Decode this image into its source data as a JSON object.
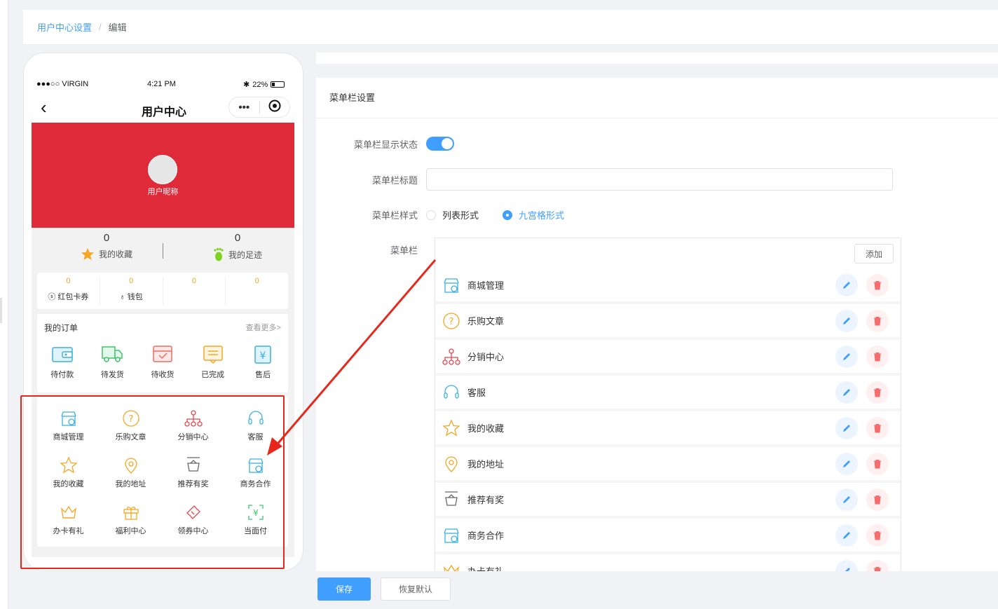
{
  "breadcrumb": {
    "parent": "用户中心设置",
    "separator": "/",
    "current": "编辑"
  },
  "phone": {
    "status": {
      "carrier": "●●●○○ VIRGIN",
      "time": "4:21 PM",
      "battery": "22%"
    },
    "nav_title": "用户中心",
    "capsule": {
      "more": "•••"
    },
    "nickname": "用户昵称",
    "stats": [
      {
        "value": "0",
        "label": "我的收藏"
      },
      {
        "value": "0",
        "label": "我的足迹"
      }
    ],
    "wallet": [
      {
        "value": "0",
        "label": "红包卡券"
      },
      {
        "value": "0",
        "label": "钱包"
      },
      {
        "value": "0",
        "label": ""
      },
      {
        "value": "0",
        "label": ""
      }
    ],
    "orders": {
      "title": "我的订单",
      "more": "查看更多>",
      "items": [
        "待付款",
        "待发货",
        "待收货",
        "已完成",
        "售后"
      ]
    },
    "menu_grid": [
      "商城管理",
      "乐购文章",
      "分销中心",
      "客服",
      "我的收藏",
      "我的地址",
      "推荐有奖",
      "商务合作",
      "办卡有礼",
      "福利中心",
      "领券中心",
      "当面付"
    ]
  },
  "panel": {
    "section_title": "菜单栏设置",
    "show_label": "菜单栏显示状态",
    "title_label": "菜单栏标题",
    "title_value": "",
    "style_label": "菜单栏样式",
    "style_options": [
      "列表形式",
      "九宫格形式"
    ],
    "style_selected": "九宫格形式",
    "menu_label": "菜单栏",
    "add_label": "添加",
    "items": [
      "商城管理",
      "乐购文章",
      "分销中心",
      "客服",
      "我的收藏",
      "我的地址",
      "推荐有奖",
      "商务合作",
      "办卡有礼"
    ]
  },
  "footer": {
    "save": "保存",
    "reset": "恢复默认"
  },
  "colors": {
    "primary": "#409eff",
    "banner": "#de2a39",
    "danger": "#f56c6c",
    "annotation": "#e8271c"
  }
}
